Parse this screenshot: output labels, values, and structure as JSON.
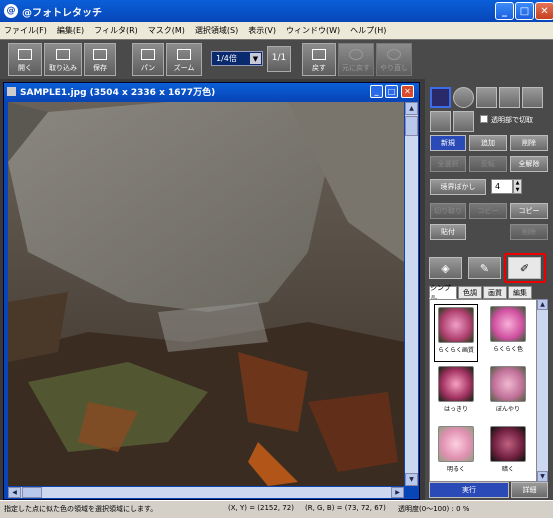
{
  "window": {
    "title": "@フォトレタッチ"
  },
  "menu": [
    "ファイル(F)",
    "編集(E)",
    "フィルタ(R)",
    "マスク(M)",
    "選択領域(S)",
    "表示(V)",
    "ウィンドウ(W)",
    "ヘルプ(H)"
  ],
  "toolbar": {
    "open": "開く",
    "import": "取り込み",
    "save": "保存",
    "pan": "パン",
    "zoom": "ズーム",
    "zoom_value": "1/4倍",
    "ratio": "1/1",
    "restore": "戻す",
    "undo": "元に戻す",
    "redo": "やり直し"
  },
  "document": {
    "title": "SAMPLE1.jpg (3504 x 2336 x 1677万色)"
  },
  "panel": {
    "transparent_cut": "透明部で切取",
    "new": "新規",
    "add": "追加",
    "delete": "削除",
    "all_select": "全選択",
    "invert": "反転",
    "all_clear": "全解除",
    "feather": "境界ぼかし",
    "feather_value": "4",
    "cut": "切り取り",
    "copy_btn": "コピー",
    "copy2": "コピー",
    "paste": "貼付",
    "delete2": "削除",
    "subtabs": [
      "シンプル",
      "色調",
      "画質",
      "編集"
    ],
    "presets": [
      "らくらく画質",
      "らくらく色",
      "はっきり",
      "ぼんやり",
      "明るく",
      "暗く"
    ],
    "execute": "実行",
    "detail": "詳細"
  },
  "status": {
    "hint": "指定した点に似た色の領域を選択領域にします。",
    "xy": "(X, Y) = (2152, 72)",
    "rgb": "(R, G, B) = (73, 72, 67)",
    "opacity": "透明度(0〜100) : 0 %"
  }
}
